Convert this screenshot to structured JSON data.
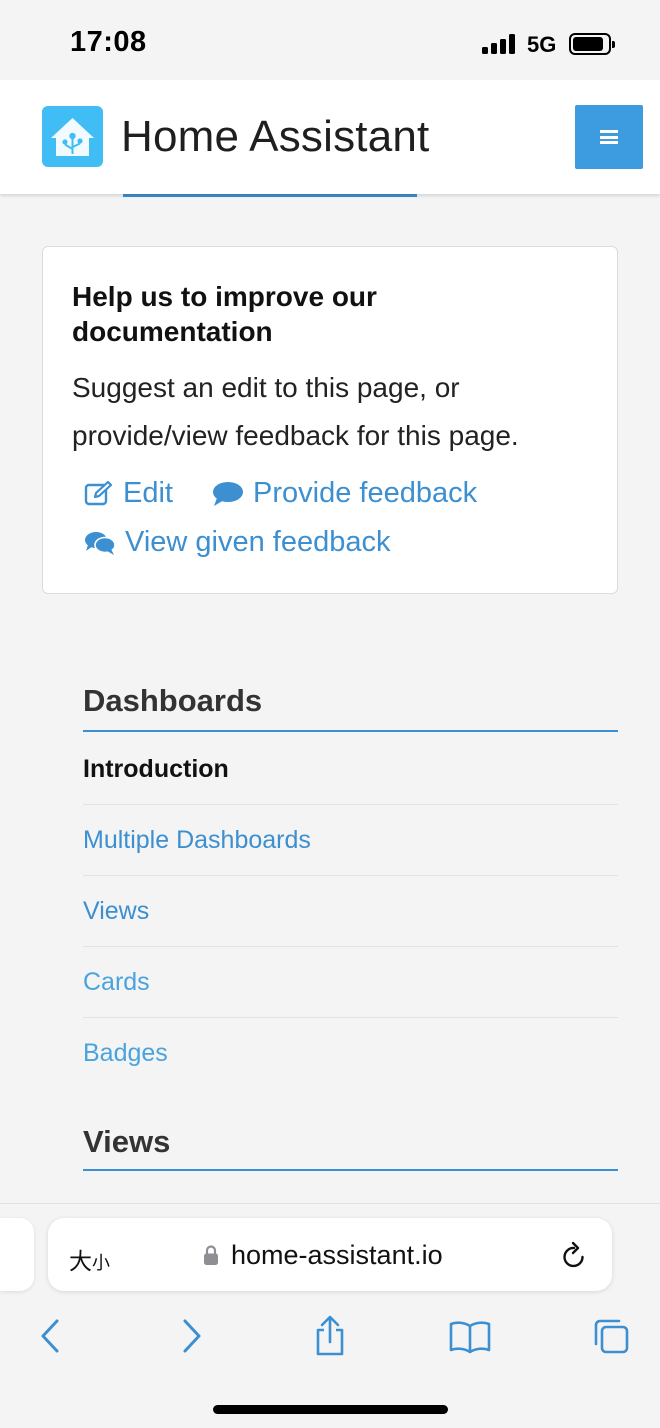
{
  "status_bar": {
    "time": "17:08",
    "network": "5G"
  },
  "header": {
    "title": "Home Assistant"
  },
  "feedback": {
    "title": "Help us to improve our documentation",
    "text": "Suggest an edit to this page, or provide/view feedback for this page.",
    "edit_label": "Edit",
    "provide_label": "Provide feedback",
    "view_label": "View given feedback"
  },
  "dashboards": {
    "heading": "Dashboards",
    "items": [
      {
        "label": "Introduction"
      },
      {
        "label": "Multiple Dashboards"
      },
      {
        "label": "Views"
      },
      {
        "label": "Cards"
      },
      {
        "label": "Badges"
      }
    ]
  },
  "views": {
    "heading": "Views"
  },
  "browser": {
    "text_size_label_large": "大",
    "text_size_label_small": "小",
    "url": "home-assistant.io"
  },
  "colors": {
    "link": "#3c8fd0",
    "brand": "#41bdf5",
    "menu_button": "#3d9be0"
  },
  "icons": [
    "edit-icon",
    "comment-icon",
    "comments-icon",
    "lock-icon",
    "reload-icon",
    "back-icon",
    "forward-icon",
    "share-icon",
    "bookmarks-icon",
    "tabs-icon",
    "menu-icon"
  ]
}
